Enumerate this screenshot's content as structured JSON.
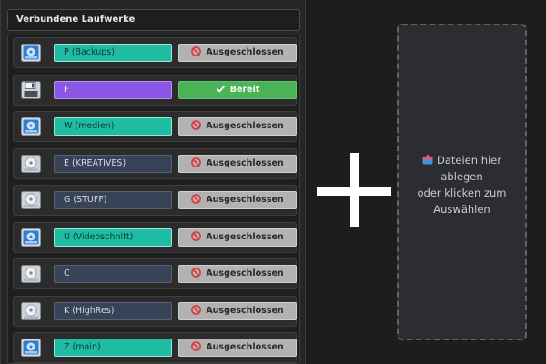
{
  "panel": {
    "title": "Verbundene Laufwerke"
  },
  "drives": [
    {
      "name": "P (Backups)",
      "color": "teal",
      "icon": "network-drive-icon",
      "status": "Ausgeschlossen",
      "state": "excluded"
    },
    {
      "name": "F",
      "color": "purple",
      "icon": "floppy-disk-icon",
      "status": "Bereit",
      "state": "ready"
    },
    {
      "name": "W (medien)",
      "color": "teal",
      "icon": "network-drive-icon",
      "status": "Ausgeschlossen",
      "state": "excluded"
    },
    {
      "name": "E (KREATIVES)",
      "color": "dark",
      "icon": "hard-drive-icon",
      "status": "Ausgeschlossen",
      "state": "excluded"
    },
    {
      "name": "G (STUFF)",
      "color": "dark",
      "icon": "hard-drive-icon",
      "status": "Ausgeschlossen",
      "state": "excluded"
    },
    {
      "name": "U (Videoschnitt)",
      "color": "teal",
      "icon": "network-drive-icon",
      "status": "Ausgeschlossen",
      "state": "excluded"
    },
    {
      "name": "C",
      "color": "dark",
      "icon": "hard-drive-icon",
      "status": "Ausgeschlossen",
      "state": "excluded"
    },
    {
      "name": "K (HighRes)",
      "color": "dark",
      "icon": "hard-drive-icon",
      "status": "Ausgeschlossen",
      "state": "excluded"
    },
    {
      "name": "Z (main)",
      "color": "teal",
      "icon": "network-drive-icon",
      "status": "Ausgeschlossen",
      "state": "excluded"
    }
  ],
  "dropzone": {
    "line1": "Dateien hier",
    "line2": "ablegen",
    "line3": "oder klicken zum",
    "line4": "Auswählen",
    "icon": "inbox-upload-icon"
  },
  "colors": {
    "teal": "#1fbba3",
    "purple": "#8a56e6",
    "ready_green": "#4cb258",
    "excluded_gray": "#b2b2b2",
    "excluded_red": "#e0353b"
  }
}
